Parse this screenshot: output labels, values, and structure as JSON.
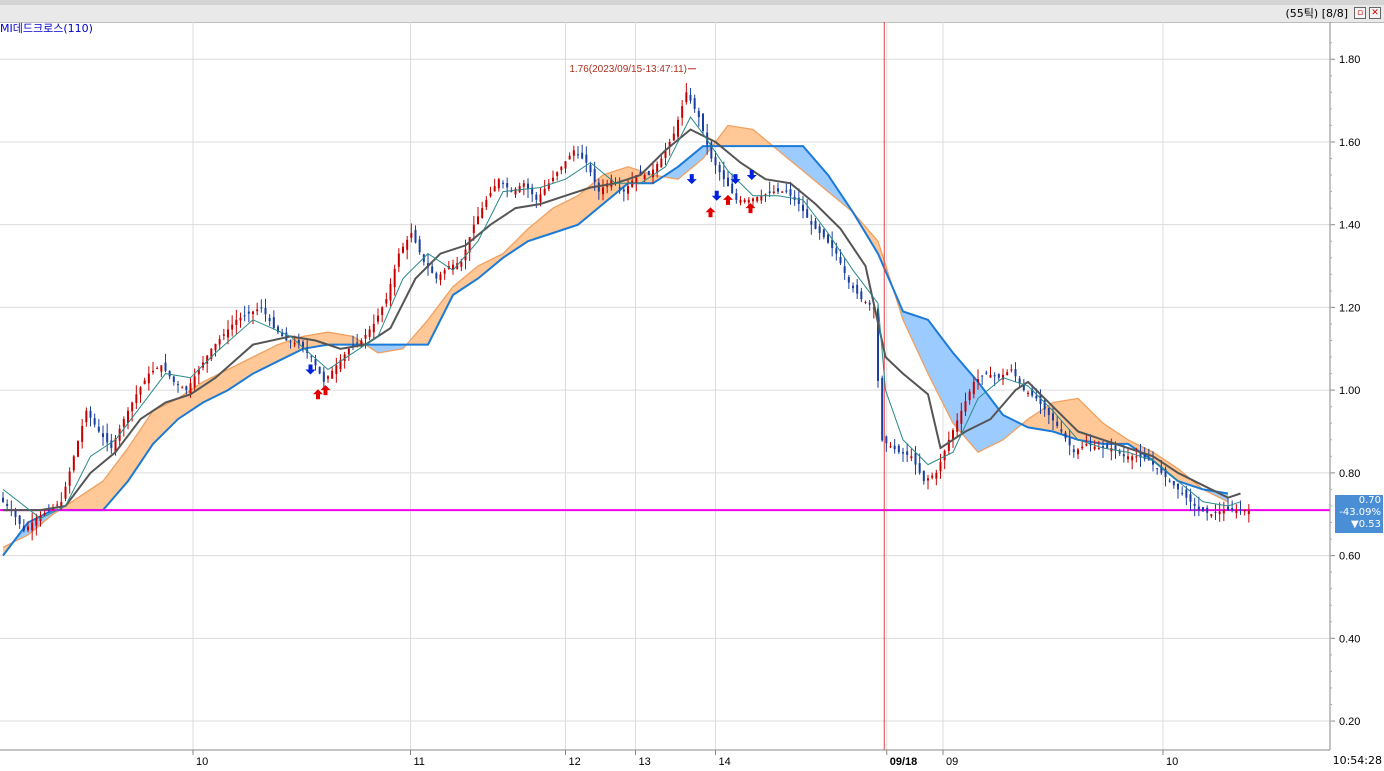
{
  "window": {
    "tick_label": "(55틱)",
    "page_label": "[8/8]",
    "maximize_icon": "maximize-icon",
    "close_icon": "close-icon"
  },
  "indicator_label": "MI데드크로스(110)",
  "x_axis_labels": [
    "10",
    "11",
    "12",
    "13",
    "14",
    "09/18",
    "09",
    "10"
  ],
  "time_label": "10:54:28",
  "last_price": {
    "price": "0.70",
    "change": "-43.09%",
    "low": "▼0.53",
    "color": "#4a8ed6"
  },
  "high_annotation": "1.76(2023/09/15-13:47:11)",
  "colors": {
    "up": "#c80000",
    "down": "#1a3fa0",
    "conversion": "#2a8a8a",
    "base": "#555555",
    "lagging": "#1a7ad8",
    "cloud_up": "#ffc896",
    "cloud_down": "#9ccbff",
    "reference_line": "#ee00ee",
    "session_line": "#e04040",
    "buy_arrow": "#e00000",
    "sell_arrow": "#0020e0"
  },
  "chart_data": {
    "type": "candlestick",
    "title": "",
    "ylim": [
      0.13,
      1.89
    ],
    "y_ticks": [
      "1.80",
      "1.60",
      "1.40",
      "1.20",
      "1.00",
      "0.80",
      "0.60",
      "0.40",
      "0.20"
    ],
    "y_tick_values": [
      1.8,
      1.6,
      1.4,
      1.2,
      1.0,
      0.8,
      0.6,
      0.4,
      0.2
    ],
    "x_tick_index": [
      15.2,
      32.6,
      45.0,
      50.6,
      57.0,
      70.7,
      75.2,
      92.8
    ],
    "reference_value": 0.71,
    "session_break_index": 70.5,
    "n_bars": 100,
    "high_index": 55.2,
    "high_value": 1.76,
    "anchors": [
      [
        0,
        0.74
      ],
      [
        1,
        0.71
      ],
      [
        2,
        0.66
      ],
      [
        3,
        0.69
      ],
      [
        5,
        0.73
      ],
      [
        6,
        0.84
      ],
      [
        7,
        0.95
      ],
      [
        8,
        0.9
      ],
      [
        9,
        0.86
      ],
      [
        10,
        0.93
      ],
      [
        11,
        0.99
      ],
      [
        12,
        1.04
      ],
      [
        13,
        1.06
      ],
      [
        14,
        1.02
      ],
      [
        15,
        1.0
      ],
      [
        17,
        1.1
      ],
      [
        19,
        1.17
      ],
      [
        21,
        1.2
      ],
      [
        22,
        1.15
      ],
      [
        23,
        1.12
      ],
      [
        24,
        1.11
      ],
      [
        25,
        1.08
      ],
      [
        26,
        1.02
      ],
      [
        27,
        1.06
      ],
      [
        28,
        1.1
      ],
      [
        29,
        1.12
      ],
      [
        30,
        1.16
      ],
      [
        31,
        1.22
      ],
      [
        32,
        1.33
      ],
      [
        33,
        1.38
      ],
      [
        34,
        1.31
      ],
      [
        35,
        1.27
      ],
      [
        36,
        1.3
      ],
      [
        37,
        1.31
      ],
      [
        38,
        1.4
      ],
      [
        39,
        1.46
      ],
      [
        40,
        1.51
      ],
      [
        41,
        1.48
      ],
      [
        42,
        1.5
      ],
      [
        43,
        1.46
      ],
      [
        45,
        1.54
      ],
      [
        46,
        1.58
      ],
      [
        47,
        1.55
      ],
      [
        48,
        1.48
      ],
      [
        49,
        1.51
      ],
      [
        50,
        1.48
      ],
      [
        51,
        1.52
      ],
      [
        52,
        1.52
      ],
      [
        53,
        1.56
      ],
      [
        54,
        1.62
      ],
      [
        55,
        1.72
      ],
      [
        56,
        1.66
      ],
      [
        57,
        1.56
      ],
      [
        58,
        1.51
      ],
      [
        59,
        1.46
      ],
      [
        60,
        1.46
      ],
      [
        61,
        1.47
      ],
      [
        62,
        1.48
      ],
      [
        63,
        1.48
      ],
      [
        64,
        1.45
      ],
      [
        65,
        1.4
      ],
      [
        66,
        1.37
      ],
      [
        67,
        1.33
      ],
      [
        68,
        1.26
      ],
      [
        69,
        1.22
      ],
      [
        70,
        1.2
      ],
      [
        70.6,
        0.88
      ],
      [
        72,
        0.85
      ],
      [
        73,
        0.84
      ],
      [
        74,
        0.78
      ],
      [
        75,
        0.8
      ],
      [
        76,
        0.88
      ],
      [
        77,
        0.95
      ],
      [
        78,
        1.02
      ],
      [
        79,
        1.04
      ],
      [
        80,
        1.03
      ],
      [
        81,
        1.05
      ],
      [
        82,
        1.0
      ],
      [
        83,
        0.98
      ],
      [
        84,
        0.94
      ],
      [
        85,
        0.9
      ],
      [
        86,
        0.85
      ],
      [
        87,
        0.87
      ],
      [
        88,
        0.86
      ],
      [
        89,
        0.86
      ],
      [
        90,
        0.84
      ],
      [
        91,
        0.84
      ],
      [
        92,
        0.83
      ],
      [
        93,
        0.8
      ],
      [
        94,
        0.77
      ],
      [
        95,
        0.74
      ],
      [
        96,
        0.71
      ],
      [
        97,
        0.7
      ],
      [
        98,
        0.71
      ],
      [
        99,
        0.71
      ]
    ],
    "conversion_line": [
      [
        0,
        0.76
      ],
      [
        3,
        0.69
      ],
      [
        5,
        0.72
      ],
      [
        7,
        0.84
      ],
      [
        9,
        0.88
      ],
      [
        11,
        0.96
      ],
      [
        13,
        1.04
      ],
      [
        15,
        1.03
      ],
      [
        17,
        1.09
      ],
      [
        20,
        1.17
      ],
      [
        23,
        1.13
      ],
      [
        26,
        1.05
      ],
      [
        28,
        1.09
      ],
      [
        30,
        1.13
      ],
      [
        32,
        1.27
      ],
      [
        34,
        1.33
      ],
      [
        36,
        1.29
      ],
      [
        38,
        1.36
      ],
      [
        40,
        1.48
      ],
      [
        43,
        1.49
      ],
      [
        45,
        1.51
      ],
      [
        47,
        1.55
      ],
      [
        49,
        1.5
      ],
      [
        51,
        1.5
      ],
      [
        53,
        1.54
      ],
      [
        55,
        1.66
      ],
      [
        56,
        1.62
      ],
      [
        58,
        1.53
      ],
      [
        60,
        1.47
      ],
      [
        62,
        1.47
      ],
      [
        64,
        1.46
      ],
      [
        66,
        1.38
      ],
      [
        68,
        1.29
      ],
      [
        70,
        1.21
      ],
      [
        70.6,
        1.0
      ],
      [
        72,
        0.88
      ],
      [
        74,
        0.82
      ],
      [
        76,
        0.85
      ],
      [
        78,
        0.98
      ],
      [
        80,
        1.03
      ],
      [
        82,
        1.01
      ],
      [
        84,
        0.95
      ],
      [
        86,
        0.88
      ],
      [
        88,
        0.86
      ],
      [
        90,
        0.85
      ],
      [
        92,
        0.83
      ],
      [
        94,
        0.78
      ],
      [
        96,
        0.73
      ],
      [
        98,
        0.72
      ],
      [
        99,
        0.73
      ]
    ],
    "base_line": [
      [
        0,
        0.71
      ],
      [
        3,
        0.71
      ],
      [
        5,
        0.72
      ],
      [
        7,
        0.8
      ],
      [
        9,
        0.85
      ],
      [
        11,
        0.93
      ],
      [
        13,
        0.97
      ],
      [
        15,
        0.99
      ],
      [
        17,
        1.03
      ],
      [
        20,
        1.11
      ],
      [
        23,
        1.13
      ],
      [
        25,
        1.12
      ],
      [
        27,
        1.1
      ],
      [
        29,
        1.11
      ],
      [
        31,
        1.15
      ],
      [
        33,
        1.27
      ],
      [
        35,
        1.33
      ],
      [
        37,
        1.35
      ],
      [
        39,
        1.4
      ],
      [
        41,
        1.44
      ],
      [
        43,
        1.45
      ],
      [
        45,
        1.47
      ],
      [
        47,
        1.49
      ],
      [
        49,
        1.5
      ],
      [
        51,
        1.52
      ],
      [
        53,
        1.58
      ],
      [
        55,
        1.63
      ],
      [
        57,
        1.6
      ],
      [
        59,
        1.55
      ],
      [
        61,
        1.51
      ],
      [
        63,
        1.5
      ],
      [
        65,
        1.45
      ],
      [
        67,
        1.39
      ],
      [
        69,
        1.3
      ],
      [
        70.6,
        1.08
      ],
      [
        72,
        1.04
      ],
      [
        74,
        0.99
      ],
      [
        75,
        0.86
      ],
      [
        77,
        0.9
      ],
      [
        79,
        0.93
      ],
      [
        81,
        1.0
      ],
      [
        82,
        1.02
      ],
      [
        84,
        0.96
      ],
      [
        86,
        0.9
      ],
      [
        88,
        0.88
      ],
      [
        90,
        0.86
      ],
      [
        92,
        0.84
      ],
      [
        94,
        0.8
      ],
      [
        96,
        0.77
      ],
      [
        98,
        0.74
      ],
      [
        99,
        0.75
      ]
    ],
    "span_a": [
      [
        0,
        0.62
      ],
      [
        2,
        0.65
      ],
      [
        4,
        0.7
      ],
      [
        6,
        0.74
      ],
      [
        8,
        0.78
      ],
      [
        10,
        0.86
      ],
      [
        12,
        0.95
      ],
      [
        14,
        0.98
      ],
      [
        16,
        1.02
      ],
      [
        18,
        1.05
      ],
      [
        20,
        1.08
      ],
      [
        22,
        1.11
      ],
      [
        24,
        1.13
      ],
      [
        26,
        1.14
      ],
      [
        28,
        1.13
      ],
      [
        30,
        1.09
      ],
      [
        32,
        1.1
      ],
      [
        34,
        1.17
      ],
      [
        36,
        1.25
      ],
      [
        38,
        1.3
      ],
      [
        40,
        1.33
      ],
      [
        42,
        1.39
      ],
      [
        44,
        1.44
      ],
      [
        46,
        1.47
      ],
      [
        48,
        1.52
      ],
      [
        50,
        1.54
      ],
      [
        52,
        1.52
      ],
      [
        54,
        1.51
      ],
      [
        56,
        1.56
      ],
      [
        58,
        1.64
      ],
      [
        60,
        1.63
      ],
      [
        62,
        1.58
      ],
      [
        64,
        1.53
      ],
      [
        66,
        1.48
      ],
      [
        68,
        1.43
      ],
      [
        70,
        1.36
      ],
      [
        72,
        1.17
      ],
      [
        74,
        1.04
      ],
      [
        76,
        0.92
      ],
      [
        78,
        0.85
      ],
      [
        80,
        0.88
      ],
      [
        82,
        0.93
      ],
      [
        84,
        0.97
      ],
      [
        86,
        0.98
      ],
      [
        88,
        0.92
      ],
      [
        90,
        0.88
      ],
      [
        92,
        0.85
      ],
      [
        94,
        0.81
      ],
      [
        96,
        0.76
      ],
      [
        98,
        0.73
      ]
    ],
    "span_b": [
      [
        0,
        0.6
      ],
      [
        2,
        0.68
      ],
      [
        4,
        0.71
      ],
      [
        6,
        0.71
      ],
      [
        8,
        0.71
      ],
      [
        10,
        0.78
      ],
      [
        12,
        0.87
      ],
      [
        14,
        0.93
      ],
      [
        16,
        0.97
      ],
      [
        18,
        1.0
      ],
      [
        20,
        1.04
      ],
      [
        22,
        1.07
      ],
      [
        24,
        1.1
      ],
      [
        26,
        1.11
      ],
      [
        28,
        1.11
      ],
      [
        30,
        1.11
      ],
      [
        32,
        1.11
      ],
      [
        34,
        1.11
      ],
      [
        36,
        1.23
      ],
      [
        38,
        1.27
      ],
      [
        40,
        1.32
      ],
      [
        42,
        1.36
      ],
      [
        44,
        1.38
      ],
      [
        46,
        1.4
      ],
      [
        48,
        1.45
      ],
      [
        50,
        1.5
      ],
      [
        52,
        1.5
      ],
      [
        54,
        1.54
      ],
      [
        56,
        1.59
      ],
      [
        58,
        1.59
      ],
      [
        60,
        1.59
      ],
      [
        62,
        1.59
      ],
      [
        64,
        1.59
      ],
      [
        66,
        1.52
      ],
      [
        68,
        1.43
      ],
      [
        70,
        1.33
      ],
      [
        72,
        1.19
      ],
      [
        74,
        1.17
      ],
      [
        76,
        1.09
      ],
      [
        78,
        1.02
      ],
      [
        80,
        0.94
      ],
      [
        82,
        0.91
      ],
      [
        84,
        0.9
      ],
      [
        86,
        0.88
      ],
      [
        88,
        0.87
      ],
      [
        90,
        0.87
      ],
      [
        92,
        0.83
      ],
      [
        94,
        0.78
      ],
      [
        96,
        0.76
      ],
      [
        98,
        0.75
      ]
    ],
    "buy_signals": [
      [
        25.8,
        1.0
      ],
      [
        56.6,
        1.43
      ],
      [
        58.0,
        1.46
      ],
      [
        59.8,
        1.44
      ],
      [
        25.2,
        0.99
      ]
    ],
    "sell_signals": [
      [
        24.6,
        1.05
      ],
      [
        55.1,
        1.51
      ],
      [
        57.1,
        1.47
      ],
      [
        58.6,
        1.51
      ],
      [
        59.9,
        1.52
      ]
    ]
  }
}
